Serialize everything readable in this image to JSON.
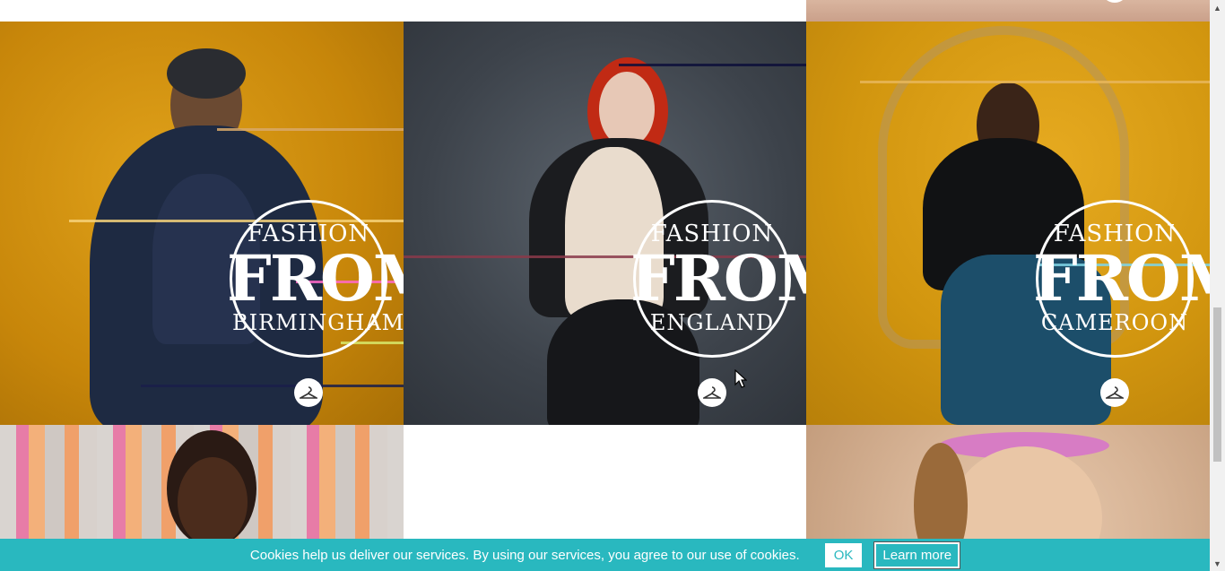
{
  "tiles": [
    {
      "id": "birmingham",
      "logo": {
        "top": "FASHION",
        "mid": "FROM",
        "bottom": "BIRMINGHAM"
      }
    },
    {
      "id": "england",
      "logo": {
        "top": "FASHION",
        "mid": "FROM",
        "bottom": "ENGLAND"
      }
    },
    {
      "id": "cameroon",
      "logo": {
        "top": "FASHION",
        "mid": "FROM",
        "bottom": "CAMEROON"
      }
    }
  ],
  "icons": {
    "hanger": "hanger-icon",
    "scroll_up": "scroll-up-arrow-icon",
    "scroll_down": "scroll-down-arrow-icon",
    "cursor": "mouse-cursor-icon"
  },
  "cookie": {
    "text": "Cookies help us deliver our services. By using our services, you agree to our use of cookies.",
    "ok_label": "OK",
    "learn_label": "Learn more"
  },
  "colors": {
    "accent": "#29b8bf",
    "mustard": "#c7860a",
    "grey": "#3d434b"
  }
}
